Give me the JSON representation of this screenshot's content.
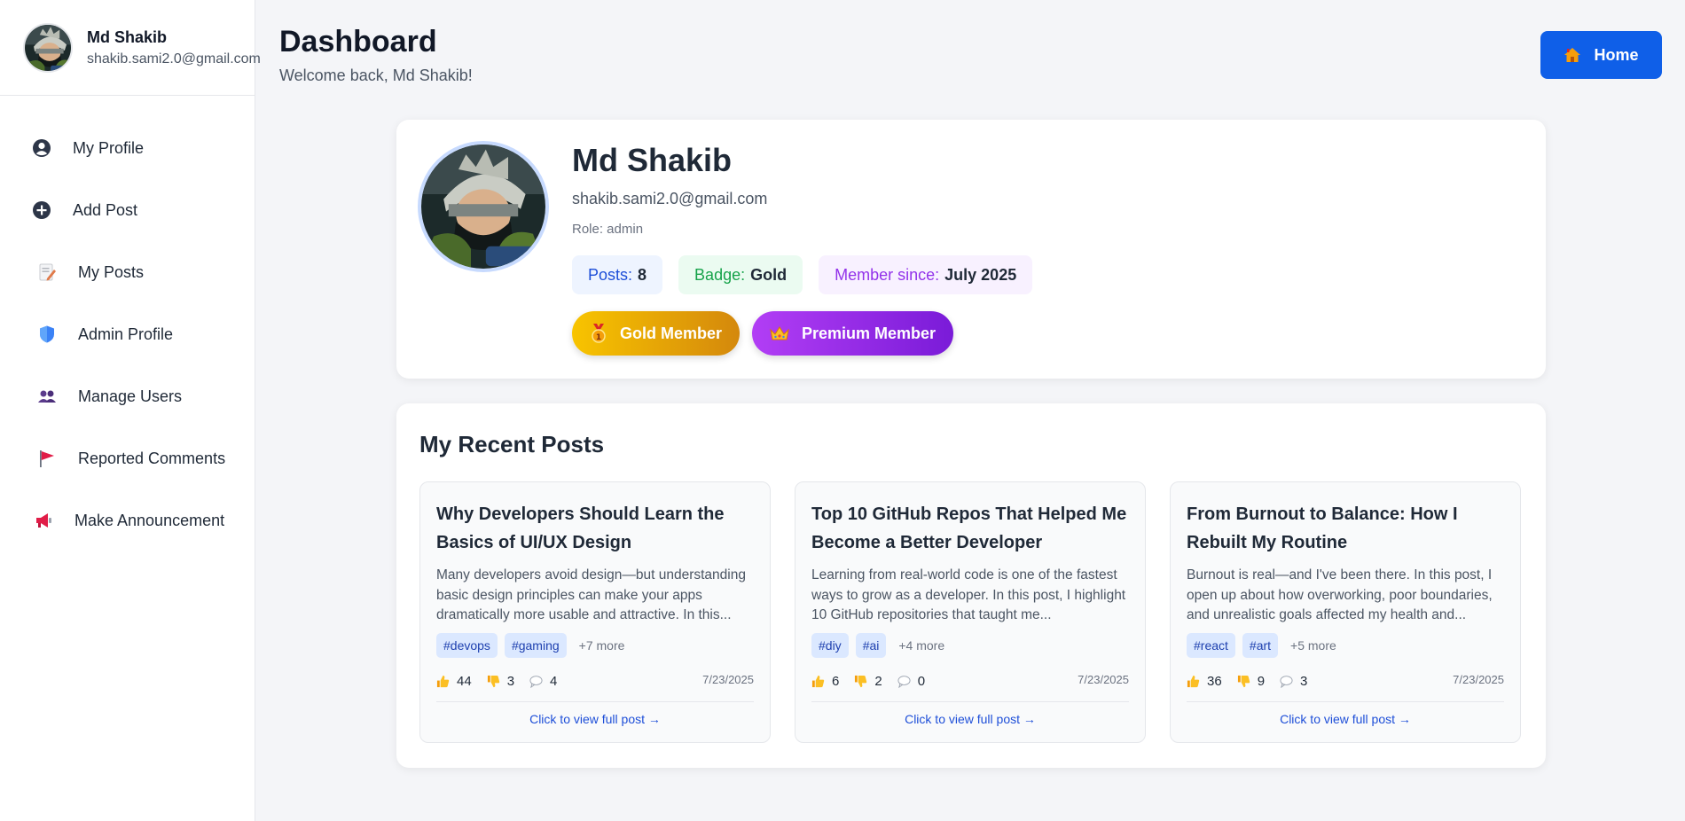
{
  "sidebar": {
    "user": {
      "name": "Md Shakib",
      "email": "shakib.sami2.0@gmail.com"
    },
    "items": [
      {
        "label": "My Profile",
        "icon": "user-circle-icon"
      },
      {
        "label": "Add Post",
        "icon": "plus-circle-icon"
      },
      {
        "label": "My Posts",
        "icon": "memo-icon"
      },
      {
        "label": "Admin Profile",
        "icon": "shield-icon"
      },
      {
        "label": "Manage Users",
        "icon": "users-icon"
      },
      {
        "label": "Reported Comments",
        "icon": "flag-icon"
      },
      {
        "label": "Make Announcement",
        "icon": "megaphone-icon"
      }
    ]
  },
  "header": {
    "title": "Dashboard",
    "subtitle": "Welcome back, Md Shakib!",
    "home_label": "Home"
  },
  "profile": {
    "name": "Md Shakib",
    "email": "shakib.sami2.0@gmail.com",
    "role": "Role: admin",
    "stats": [
      {
        "label": "Posts:",
        "value": "8",
        "color": "#1d4ed8"
      },
      {
        "label": "Badge:",
        "value": "Gold",
        "color": "#16a34a"
      },
      {
        "label": "Member since:",
        "value": "July 2025",
        "color": "#9333ea"
      }
    ],
    "badges": [
      {
        "label": "Gold Member",
        "icon": "medal-icon"
      },
      {
        "label": "Premium Member",
        "icon": "crown-icon"
      }
    ]
  },
  "recent_posts": {
    "title": "My Recent Posts",
    "view_label": "Click to view full post →",
    "posts": [
      {
        "title": "Why Developers Should Learn the Basics of UI/UX Design",
        "excerpt": "Many developers avoid design—but understanding basic design principles can make your apps dramatically more usable and attractive. In this...",
        "tags": [
          "#devops",
          "#gaming"
        ],
        "more": "+7 more",
        "likes": "44",
        "dislikes": "3",
        "comments": "4",
        "date": "7/23/2025"
      },
      {
        "title": "Top 10 GitHub Repos That Helped Me Become a Better Developer",
        "excerpt": "Learning from real-world code is one of the fastest ways to grow as a developer. In this post, I highlight 10 GitHub repositories that taught me...",
        "tags": [
          "#diy",
          "#ai"
        ],
        "more": "+4 more",
        "likes": "6",
        "dislikes": "2",
        "comments": "0",
        "date": "7/23/2025"
      },
      {
        "title": "From Burnout to Balance: How I Rebuilt My Routine",
        "excerpt": "Burnout is real—and I've been there. In this post, I open up about how overworking, poor boundaries, and unrealistic goals affected my health and...",
        "tags": [
          "#react",
          "#art"
        ],
        "more": "+5 more",
        "likes": "36",
        "dislikes": "9",
        "comments": "3",
        "date": "7/23/2025"
      }
    ]
  }
}
